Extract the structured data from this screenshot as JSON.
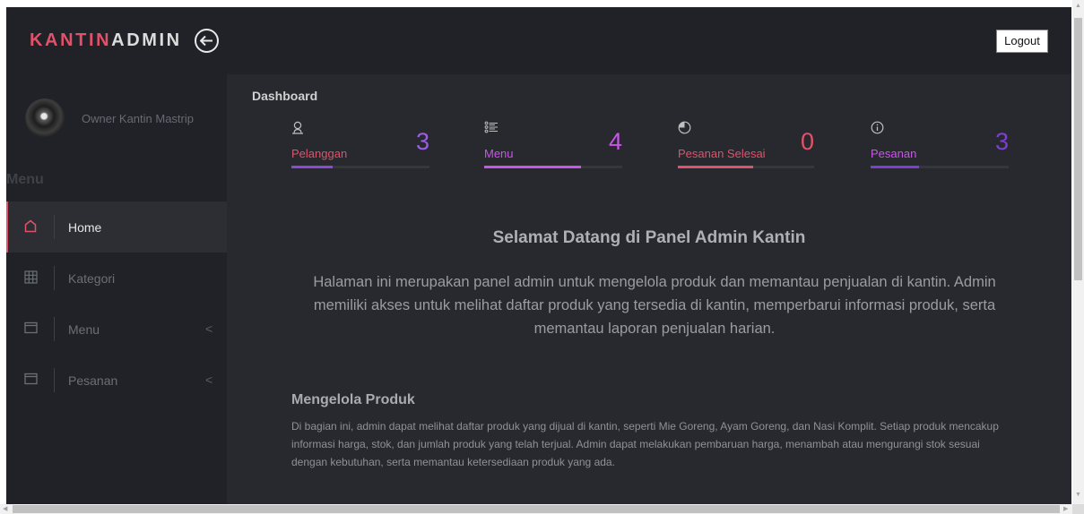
{
  "header": {
    "brand_part1": "KANTIN",
    "brand_part2": "ADMIN",
    "logout_label": "Logout"
  },
  "sidebar": {
    "owner_name": "Owner Kantin Mastrip",
    "menu_heading": "Menu",
    "items": [
      {
        "label": "Home",
        "icon": "home-icon",
        "active": true,
        "has_caret": false
      },
      {
        "label": "Kategori",
        "icon": "grid-icon",
        "active": false,
        "has_caret": false
      },
      {
        "label": "Menu",
        "icon": "window-icon",
        "active": false,
        "has_caret": true
      },
      {
        "label": "Pesanan",
        "icon": "window-icon",
        "active": false,
        "has_caret": true
      }
    ],
    "caret": "<"
  },
  "main": {
    "page_title": "Dashboard",
    "stats": [
      {
        "label": "Pelanggan",
        "value": "3",
        "icon": "user-icon",
        "label_color": "#e0526a",
        "value_color": "#9b5de5",
        "bar_color": "#8a4ad6",
        "progress": 0.3
      },
      {
        "label": "Menu",
        "value": "4",
        "icon": "list-icon",
        "label_color": "#c956e8",
        "value_color": "#c956e8",
        "bar_color": "#c956e8",
        "progress": 0.7
      },
      {
        "label": "Pesanan Selesai",
        "value": "0",
        "icon": "pie-icon",
        "label_color": "#e0526a",
        "value_color": "#e0526a",
        "bar_color": "#e0526a",
        "progress": 0.55
      },
      {
        "label": "Pesanan",
        "value": "3",
        "icon": "info-icon",
        "label_color": "#c956e8",
        "value_color": "#7c3fd1",
        "bar_color": "#7c3fd1",
        "progress": 0.35
      }
    ],
    "welcome_title": "Selamat Datang di Panel Admin Kantin",
    "welcome_text": "Halaman ini merupakan panel admin untuk mengelola produk dan memantau penjualan di kantin. Admin memiliki akses untuk melihat daftar produk yang tersedia di kantin, memperbarui informasi produk, serta memantau laporan penjualan harian.",
    "section_title": "Mengelola Produk",
    "section_text": "Di bagian ini, admin dapat melihat daftar produk yang dijual di kantin, seperti Mie Goreng, Ayam Goreng, dan Nasi Komplit. Setiap produk mencakup informasi harga, stok, dan jumlah produk yang telah terjual. Admin dapat melakukan pembaruan harga, menambah atau mengurangi stok sesuai dengan kebutuhan, serta memantau ketersediaan produk yang ada."
  },
  "colors": {
    "accent": "#e0526a",
    "purple": "#9b5de5",
    "sidebar_bg": "#202227",
    "main_bg": "#27292e"
  }
}
